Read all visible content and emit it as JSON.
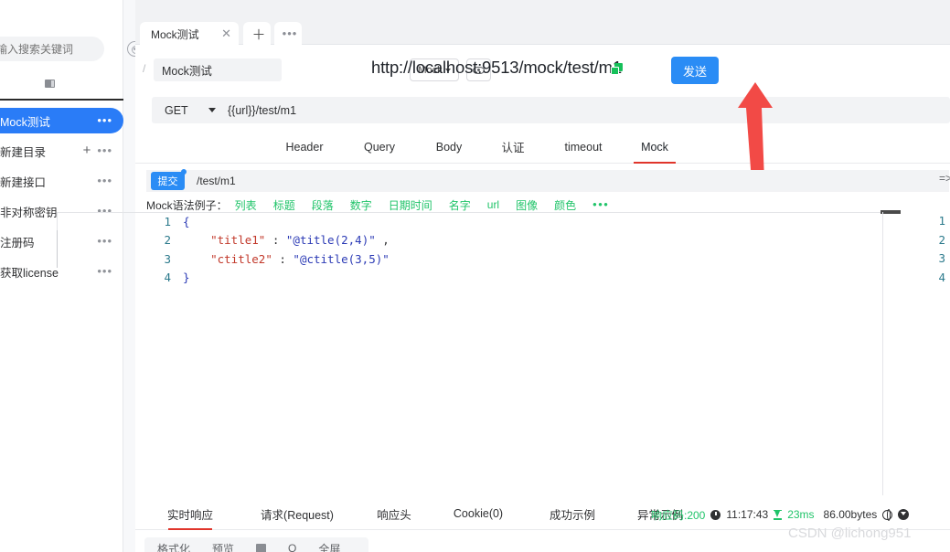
{
  "sidebar": {
    "search": {
      "placeholder": "请输入搜索关键词",
      "value": ""
    },
    "target_icon": "target-icon",
    "folder_icon": "folder-icon",
    "items": [
      {
        "label": "Mock测试",
        "active": true,
        "more": "•••"
      },
      {
        "label": "新建目录",
        "active": false,
        "more": "•••",
        "plus": "+"
      },
      {
        "label": "新建接口",
        "active": false,
        "more": "•••"
      },
      {
        "label": "非对称密钥",
        "active": false,
        "more": "•••"
      },
      {
        "label": "注册码",
        "active": false,
        "more": "•••"
      },
      {
        "label": "获取license",
        "active": false,
        "more": "•••"
      }
    ]
  },
  "tabstrip": {
    "tabs": [
      {
        "label": "Mock测试",
        "close": "✕"
      }
    ],
    "add_label": "＋",
    "more_label": "•••"
  },
  "address": {
    "breadcrumb_slash": "/",
    "name_value": "Mock测试",
    "type_select": "Mock",
    "eye_icon": "eye-icon",
    "url": "http://localhost:9513/mock/test/m1",
    "copy_icon": "copy-icon",
    "send_label": "发送"
  },
  "request": {
    "method": "GET",
    "url_template": "{{url}}/test/m1",
    "tabs": [
      {
        "label": "Header",
        "active": false
      },
      {
        "label": "Query",
        "active": false
      },
      {
        "label": "Body",
        "active": false
      },
      {
        "label": "认证",
        "active": false
      },
      {
        "label": "timeout",
        "active": false
      },
      {
        "label": "Mock",
        "active": true
      }
    ]
  },
  "mock": {
    "submit_label": "提交",
    "path": "/test/m1",
    "arrow_chip": "=>",
    "syntax_label": "Mock语法例子：",
    "syntax_links": [
      "列表",
      "标题",
      "段落",
      "数字",
      "日期时间",
      "名字",
      "url",
      "图像",
      "颜色"
    ],
    "syntax_more": "•••",
    "editor_lines": [
      {
        "num": "1",
        "indent": "",
        "text": "{",
        "type": "brace"
      },
      {
        "num": "2",
        "indent": "    ",
        "key": "\"title1\"",
        "colon": " : ",
        "value": "\"@title(2,4)\"",
        "tail": " ,",
        "type": "pair"
      },
      {
        "num": "3",
        "indent": "    ",
        "key": "\"ctitle2\"",
        "colon": " : ",
        "value": "\"@ctitle(3,5)\"",
        "tail": "",
        "type": "pair"
      },
      {
        "num": "4",
        "indent": "",
        "text": "}",
        "type": "brace"
      }
    ],
    "right_line_numbers": [
      "1",
      "2",
      "3",
      "4"
    ]
  },
  "response": {
    "tabs": [
      {
        "label": "实时响应",
        "active": true
      },
      {
        "label": "请求(Request)",
        "active": false
      },
      {
        "label": "响应头",
        "active": false
      },
      {
        "label": "Cookie(0)",
        "active": false
      },
      {
        "label": "成功示例",
        "active": false
      },
      {
        "label": "异常示例",
        "active": false
      }
    ],
    "status_code": "响应码:200",
    "clock_icon": "clock-icon",
    "timestamp": "11:17:43",
    "hourglass_icon": "hourglass-icon",
    "duration": "23ms",
    "size": "86.00bytes",
    "globe_icon": "globe-icon",
    "download_icon": "download-icon"
  },
  "bottom_toolbar": {
    "items": [
      "格式化",
      "预览"
    ],
    "copy_icon": "copy-icon",
    "search_label": "Q",
    "fullscreen": "全屏"
  },
  "annotation": {
    "arrow_color": "#f24a46",
    "arrow_icon": "up-arrow-annotation"
  },
  "watermark": "CSDN @lichong951",
  "colors": {
    "accent_blue": "#2a8cf5",
    "active_red": "#e0352b",
    "green": "#21c46a",
    "copy_green": "#17c05a",
    "arrow_red": "#f24a46"
  }
}
